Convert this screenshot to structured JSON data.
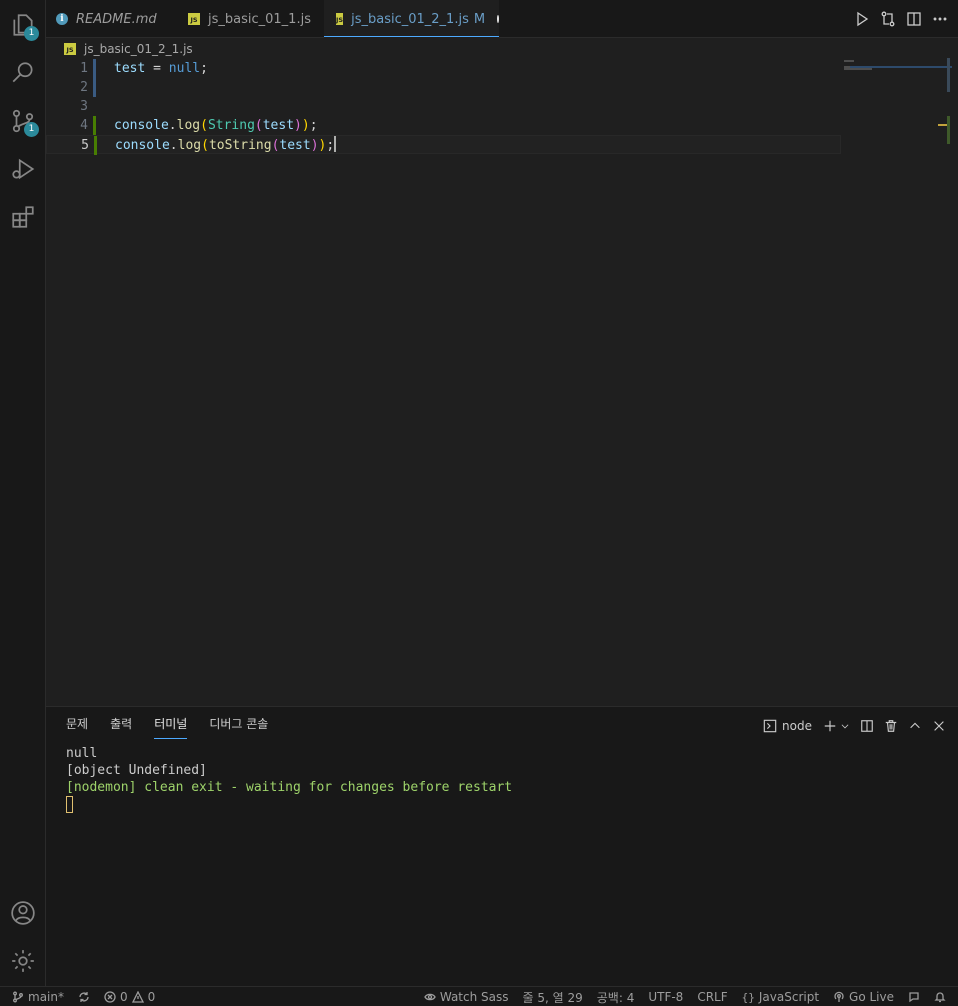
{
  "activity_bar": {
    "explorer_badge": "1",
    "scm_badge": "1"
  },
  "tabs": [
    {
      "title": "README.md",
      "kind": "info"
    },
    {
      "title": "js_basic_01_1.js",
      "kind": "js"
    },
    {
      "title": "js_basic_01_2_1.js",
      "kind": "js",
      "status": "M"
    }
  ],
  "breadcrumb": {
    "file": "js_basic_01_2_1.js",
    "icon_label": "JS"
  },
  "editor": {
    "line_numbers": [
      "1",
      "2",
      "3",
      "4",
      "5"
    ],
    "lines": [
      {
        "t1": "test",
        "t2": " = ",
        "t3": "null",
        "t4": ";"
      },
      {},
      {},
      {
        "obj": "console",
        "dot": ".",
        "fn": "log",
        "p1": "(",
        "cls": "String",
        "p2": "(",
        "arg": "test",
        "p3": ")",
        "p4": ")",
        "end": ";"
      },
      {
        "obj": "console",
        "dot": ".",
        "fn": "log",
        "p1": "(",
        "cls": "toString",
        "p2": "(",
        "arg": "test",
        "p3": ")",
        "p4": ")",
        "end": ";"
      }
    ]
  },
  "panel": {
    "tabs": [
      "문제",
      "출력",
      "터미널",
      "디버그 콘솔"
    ],
    "terminal_name": "node",
    "output": [
      "null",
      "[object Undefined]",
      "[nodemon] clean exit - waiting for changes before restart"
    ]
  },
  "status_bar": {
    "branch": "main*",
    "errors": "0",
    "warnings": "0",
    "watch_sass": "Watch Sass",
    "position": "줄 5, 열 29",
    "spaces": "공백: 4",
    "encoding": "UTF-8",
    "eol": "CRLF",
    "language": "JavaScript",
    "go_live": "Go Live"
  },
  "colors": {
    "accent": "#4daaff",
    "badge": "#2b8a9b",
    "js_icon": "#cbcb41"
  }
}
